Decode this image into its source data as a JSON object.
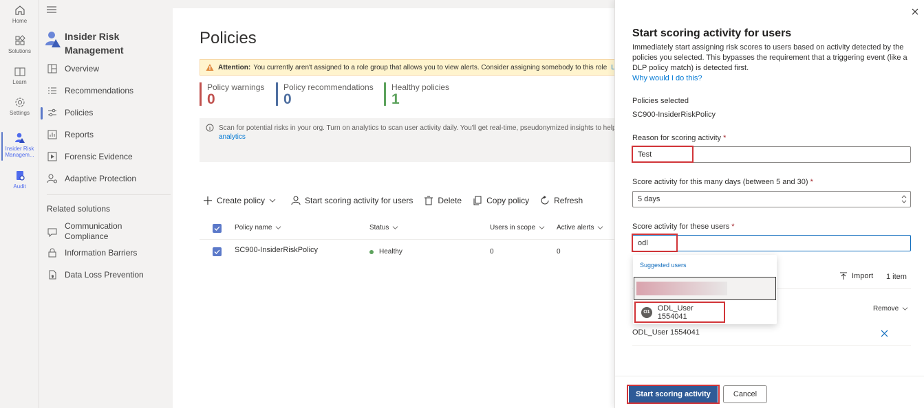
{
  "rail": {
    "items": [
      {
        "label": "Home",
        "icon": "home-icon"
      },
      {
        "label": "Solutions",
        "icon": "grid-icon"
      },
      {
        "label": "Learn",
        "icon": "book-icon"
      },
      {
        "label": "Settings",
        "icon": "gear-icon"
      },
      {
        "label": "Insider Risk Managem...",
        "icon": "insider-risk-icon"
      },
      {
        "label": "Audit",
        "icon": "audit-icon"
      }
    ]
  },
  "nav": {
    "menu_icon": "hamburger-icon",
    "title_line1": "Insider Risk",
    "title_line2": "Management",
    "items": [
      {
        "label": "Overview",
        "icon": "overview-icon"
      },
      {
        "label": "Recommendations",
        "icon": "list-icon"
      },
      {
        "label": "Policies",
        "icon": "sliders-icon"
      },
      {
        "label": "Reports",
        "icon": "chart-icon"
      },
      {
        "label": "Forensic Evidence",
        "icon": "play-icon"
      },
      {
        "label": "Adaptive Protection",
        "icon": "person-gear-icon"
      }
    ],
    "related_heading": "Related solutions",
    "related": [
      {
        "label_line1": "Communication",
        "label_line2": "Compliance",
        "icon": "chat-icon"
      },
      {
        "label": "Information Barriers",
        "icon": "lock-icon"
      },
      {
        "label": "Data Loss Prevention",
        "icon": "shield-doc-icon"
      }
    ]
  },
  "main": {
    "title": "Policies",
    "attention_label": "Attention:",
    "attention_text": "You currently aren't assigned to a role group that allows you to view alerts. Consider assigning somebody to this role",
    "attention_link": "Learn m",
    "kpis": [
      {
        "label": "Policy warnings",
        "value": "0",
        "color": "#c0504d"
      },
      {
        "label": "Policy recommendations",
        "value": "0",
        "color": "#4f6fa0"
      },
      {
        "label": "Healthy policies",
        "value": "1",
        "color": "#5ca25c"
      }
    ],
    "scan_text": "Scan for potential risks in your org. Turn on analytics to scan user activity daily. You'll get real-time, pseudonymized insights to help you",
    "scan_link": "analytics",
    "toolbar": {
      "create": "Create policy",
      "start_scoring": "Start scoring activity for users",
      "delete": "Delete",
      "copy": "Copy policy",
      "refresh": "Refresh"
    },
    "columns": [
      "Policy name",
      "Status",
      "Users in scope",
      "Active alerts"
    ],
    "rows": [
      {
        "name": "SC900-InsiderRiskPolicy",
        "status": "Healthy",
        "users": "0",
        "alerts": "0",
        "status_color": "#5ca25c"
      }
    ]
  },
  "panel": {
    "title": "Start scoring activity for users",
    "description": "Immediately start assigning risk scores to users based on activity detected by the policies you selected. This bypasses the requirement that a triggering event (like a DLP policy match) is detected first.",
    "why_link": "Why would I do this?",
    "policies_label": "Policies selected",
    "policies_value": "SC900-InsiderRiskPolicy",
    "reason_label": "Reason for scoring activity",
    "reason_value": "Test",
    "days_label": "Score activity for this many days (between 5 and 30)",
    "days_value": "5 days",
    "users_label": "Score activity for these users",
    "users_value": "odl",
    "required_mark": "*",
    "suggested_heading": "Suggested users",
    "suggested_user_initials": "O1",
    "suggested_user_name": "ODL_User 1554041",
    "import_label": "Import",
    "item_count": "1 item",
    "remove_label": "Remove",
    "selected_user": "ODL_User 1554041",
    "start_button": "Start scoring activity",
    "cancel_button": "Cancel"
  }
}
